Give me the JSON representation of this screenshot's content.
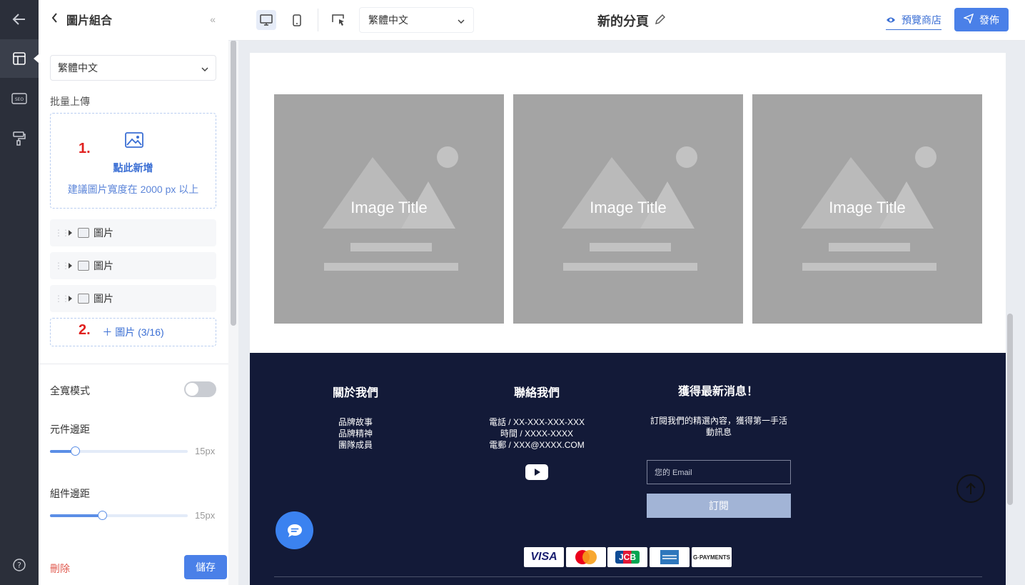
{
  "panel": {
    "title": "圖片組合",
    "language": "繁體中文",
    "bulk_upload_label": "批量上傳",
    "upload_title": "點此新增",
    "upload_hint": "建議圖片寬度在 2000 px 以上",
    "step1": "1.",
    "step2": "2.",
    "items": [
      {
        "label": "圖片"
      },
      {
        "label": "圖片"
      },
      {
        "label": "圖片"
      }
    ],
    "add_label": "＋ 圖片 (3/16)",
    "fullwidth_label": "全寬模式",
    "fullwidth_on": false,
    "element_spacing_label": "元件邊距",
    "element_spacing_value": "15px",
    "element_spacing_level": 0.18,
    "group_spacing_label": "組件邊距",
    "group_spacing_value": "15px",
    "group_spacing_level": 0.38,
    "delete_label": "刪除",
    "save_label": "儲存"
  },
  "toolbar": {
    "language": "繁體中文",
    "page_title": "新的分頁",
    "preview_label": "預覽商店",
    "publish_label": "發佈"
  },
  "canvas": {
    "cards": [
      {
        "title": "Image Title"
      },
      {
        "title": "Image Title"
      },
      {
        "title": "Image Title"
      }
    ],
    "footer": {
      "about_title": "關於我們",
      "about_links": [
        "品牌故事",
        "品牌精神",
        "團隊成員"
      ],
      "contact_title": "聯絡我們",
      "contact_lines": [
        "電話 / XX-XXX-XXX-XXX",
        "時間 / XXXX-XXXX",
        "電郵 / XXX@XXXX.COM"
      ],
      "news_title": "獲得最新消息！",
      "news_desc_1": "訂閱我們的精選內容，獲得第一手活",
      "news_desc_2": "動訊息",
      "email_placeholder": "您的 Email",
      "subscribe_label": "訂閱",
      "payments": [
        "VISA",
        "",
        "JCB",
        "",
        "G·PAYMENTS"
      ]
    }
  },
  "colors": {
    "accent": "#4a80e8",
    "rail": "#2b2f3a",
    "footer_bg": "#131a38",
    "placeholder": "#a4a4a4"
  }
}
